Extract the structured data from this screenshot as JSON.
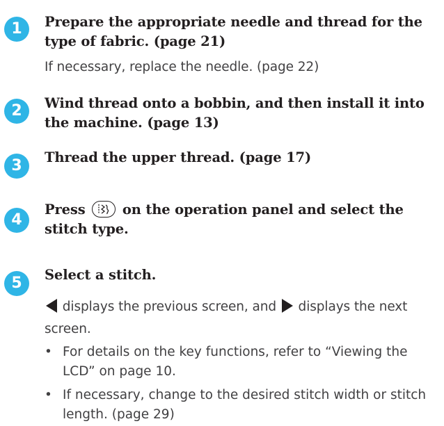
{
  "steps": [
    {
      "number": "1",
      "heading": "Prepare the appropriate needle and thread for the type of fabric. (page 21)",
      "note": "If necessary, replace the needle. (page 22)"
    },
    {
      "number": "2",
      "heading": "Wind thread onto a bobbin, and then install it into the machine. (page 13)"
    },
    {
      "number": "3",
      "heading": "Thread the upper thread. (page 17)"
    },
    {
      "number": "4",
      "heading_before": "Press",
      "heading_after": "on the operation panel and select the stitch type.",
      "key_icon": "utility-stitch-key-icon"
    },
    {
      "number": "5",
      "heading": "Select a stitch.",
      "nav_line_part1": "displays the previous screen, and",
      "nav_line_part2": "displays the next screen.",
      "prev_icon": "left-triangle-icon",
      "next_icon": "right-triangle-icon",
      "bullets": [
        "For details on the key functions, refer to “Viewing the LCD” on page 10.",
        "If necessary, change to the desired stitch width or stitch length. (page 29)"
      ]
    }
  ],
  "colors": {
    "badge": "#2fb5e6",
    "heading": "#231f20",
    "body": "#414042"
  }
}
